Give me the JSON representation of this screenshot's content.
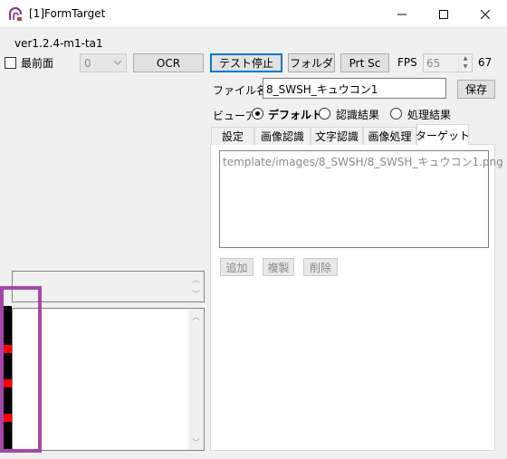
{
  "window": {
    "title": "[1]FormTarget"
  },
  "version": "ver1.2.4-m1-ta1",
  "controls": {
    "topmost_label": "最前面",
    "topmost_checked": false,
    "combo_value": "0",
    "ocr_label": "OCR",
    "test_stop_label": "テスト停止",
    "folder_label": "フォルダ",
    "prtsc_label": "Prt Sc",
    "fps_label": "FPS",
    "fps_value": "65",
    "fps_actual": "67"
  },
  "file": {
    "label": "ファイル名",
    "value": "8_SWSH_キュウコン1",
    "save_label": "保存"
  },
  "viewer": {
    "label": "ビューア",
    "options": [
      "デフォルト",
      "認識結果",
      "処理結果"
    ],
    "selected": "デフォルト"
  },
  "tabs": [
    "設定",
    "画像認識",
    "文字認識",
    "画像処理",
    "ターゲット"
  ],
  "active_tab": "ターゲット",
  "target_panel": {
    "items": [
      "template/images/8_SWSH/8_SWSH_キュウコン1.png"
    ],
    "add_label": "追加",
    "copy_label": "複製",
    "delete_label": "削除"
  },
  "icons": {
    "app": "app-logo-icon",
    "minimize": "minimize-icon",
    "maximize": "maximize-icon",
    "close": "close-icon"
  },
  "colors": {
    "highlight": "#a547a8",
    "marker": "#ff0000",
    "focus": "#0078d7"
  }
}
